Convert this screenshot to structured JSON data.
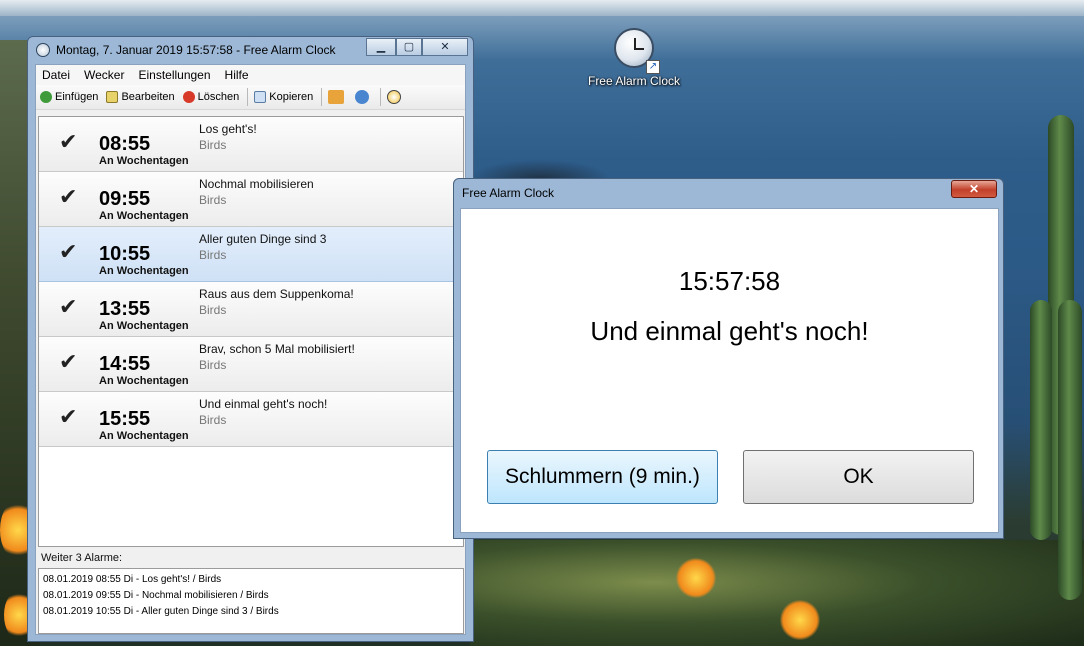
{
  "desktop": {
    "icon_label": "Free Alarm Clock"
  },
  "main_window": {
    "title": "Montag, 7. Januar 2019 15:57:58 - Free Alarm Clock",
    "menu": [
      "Datei",
      "Wecker",
      "Einstellungen",
      "Hilfe"
    ],
    "toolbar": {
      "add": "Einfügen",
      "edit": "Bearbeiten",
      "delete": "Löschen",
      "copy": "Kopieren"
    },
    "alarms": [
      {
        "time": "08:55",
        "days": "An Wochentagen",
        "label": "Los geht's!",
        "sound": "Birds",
        "checked": true
      },
      {
        "time": "09:55",
        "days": "An Wochentagen",
        "label": "Nochmal mobilisieren",
        "sound": "Birds",
        "checked": true
      },
      {
        "time": "10:55",
        "days": "An Wochentagen",
        "label": "Aller guten Dinge sind 3",
        "sound": "Birds",
        "checked": true,
        "selected": true
      },
      {
        "time": "13:55",
        "days": "An Wochentagen",
        "label": "Raus aus dem Suppenkoma!",
        "sound": "Birds",
        "checked": true
      },
      {
        "time": "14:55",
        "days": "An Wochentagen",
        "label": "Brav, schon 5 Mal mobilisiert!",
        "sound": "Birds",
        "checked": true
      },
      {
        "time": "15:55",
        "days": "An Wochentagen",
        "label": "Und einmal geht's noch!",
        "sound": "Birds",
        "checked": true
      }
    ],
    "next_alarms_label": "Weiter 3 Alarme:",
    "next_alarms": [
      "08.01.2019 08:55 Di - Los geht's! / Birds",
      "08.01.2019 09:55 Di - Nochmal mobilisieren / Birds",
      "08.01.2019 10:55 Di - Aller guten Dinge sind 3 / Birds"
    ]
  },
  "dialog": {
    "title": "Free Alarm Clock",
    "time": "15:57:58",
    "message": "Und einmal geht's noch!",
    "snooze_label": "Schlummern (9 min.)",
    "ok_label": "OK"
  },
  "colors": {
    "window_frame": "#9cb8d6",
    "selected_row": "#cfe1f6",
    "close_button": "#c2402a"
  }
}
